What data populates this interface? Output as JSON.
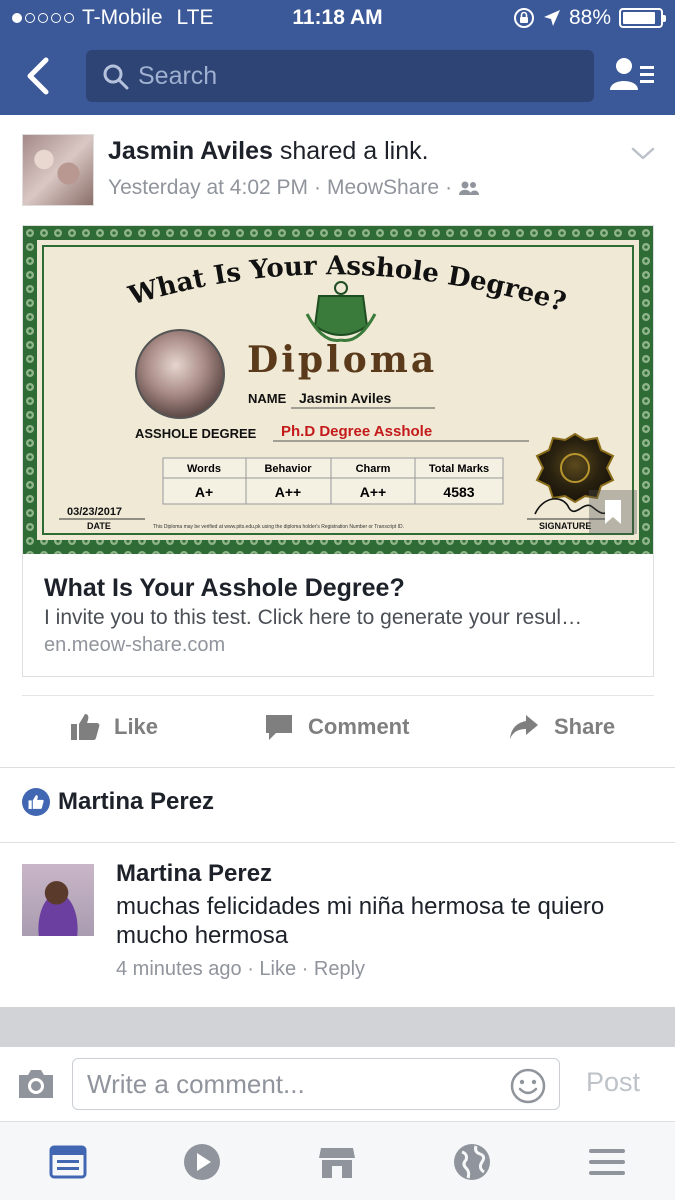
{
  "status_bar": {
    "carrier": "T-Mobile",
    "network": "LTE",
    "time": "11:18 AM",
    "battery": "88%",
    "battery_level": 0.88
  },
  "header": {
    "search_placeholder": "Search"
  },
  "post": {
    "author": "Jasmin Aviles",
    "action": "shared a link.",
    "time": "Yesterday at 4:02 PM",
    "app": "MeowShare",
    "link": {
      "title": "What Is Your Asshole Degree?",
      "description": "I invite you to this test. Click here to generate your resul…",
      "domain": "en.meow-share.com",
      "image": {
        "headline": "What Is Your Asshole Degree?",
        "diploma_word": "Diploma",
        "name_label": "NAME",
        "name_value": "Jasmin Aviles",
        "degree_label": "ASSHOLE DEGREE",
        "degree_value": "Ph.D Degree Asshole",
        "table_headers": [
          "Words",
          "Behavior",
          "Charm",
          "Total Marks"
        ],
        "table_values": [
          "A+",
          "A++",
          "A++",
          "4583"
        ],
        "date_value": "03/23/2017",
        "date_label": "DATE",
        "signature_label": "SIGNATURE",
        "footnote": "This Diploma may be verified at www.pits.edu.pk using the diploma holder's Registration Number or Transcript ID."
      }
    },
    "actions": {
      "like": "Like",
      "comment": "Comment",
      "share": "Share"
    }
  },
  "likes": {
    "name": "Martina Perez"
  },
  "comment": {
    "author": "Martina Perez",
    "text": "muchas felicidades mi niña hermosa te quiero mucho hermosa",
    "time": "4 minutes ago",
    "like": "Like",
    "reply": "Reply"
  },
  "composer": {
    "placeholder": "Write a comment...",
    "post_label": "Post"
  },
  "colors": {
    "brand": "#3b5998",
    "link_blue": "#4267b2",
    "muted": "#90949c"
  },
  "icons": [
    "back-icon",
    "search-icon",
    "friends-icon",
    "chevron-down-icon",
    "friends-audience-icon",
    "like-icon",
    "comment-icon",
    "share-icon",
    "camera-icon",
    "emoji-icon",
    "news-feed-icon",
    "video-icon",
    "marketplace-icon",
    "globe-icon",
    "menu-icon"
  ]
}
